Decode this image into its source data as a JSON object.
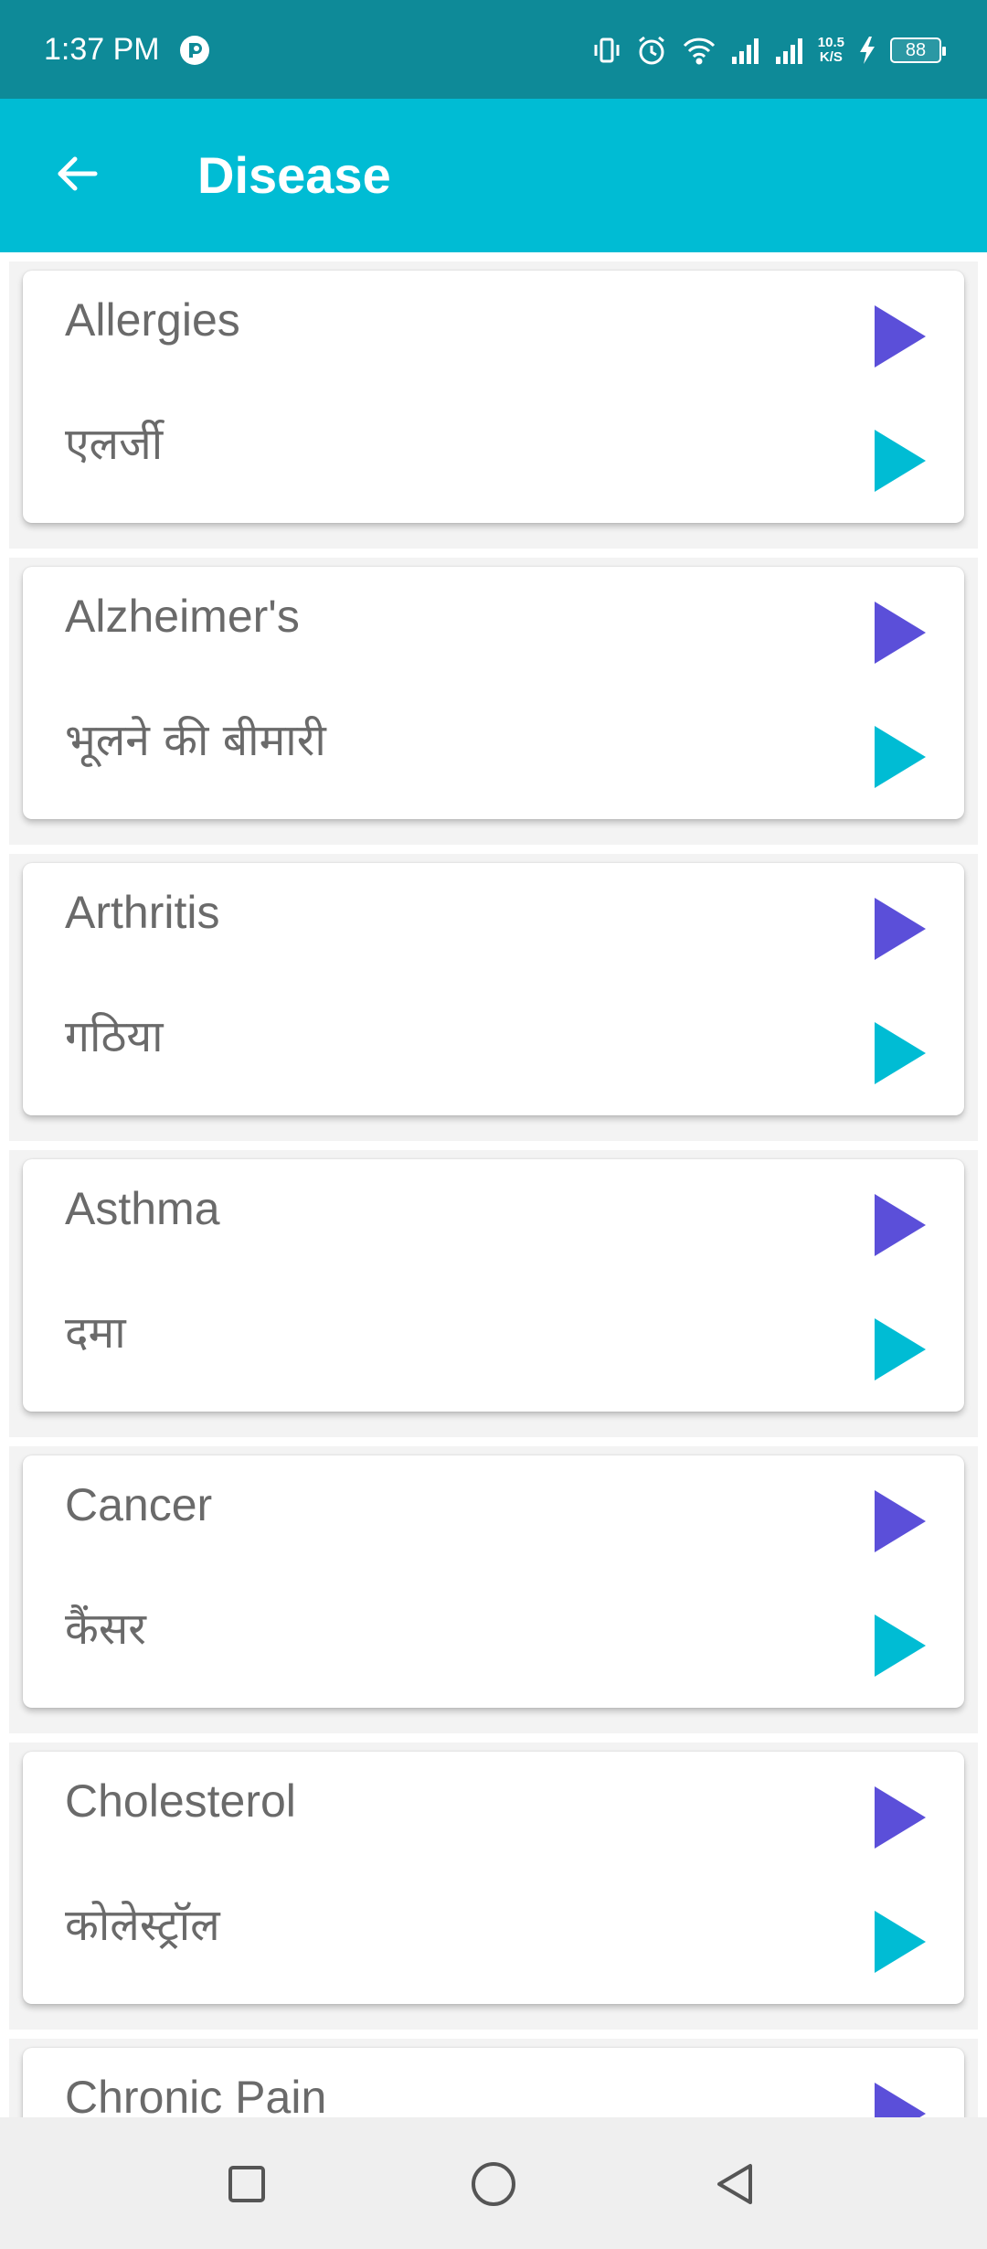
{
  "status_bar": {
    "time": "1:37 PM",
    "net_speed_value": "10.5",
    "net_speed_unit": "K/S",
    "battery_level": "88"
  },
  "app_bar": {
    "title": "Disease",
    "background_color": "#00bcd4"
  },
  "colors": {
    "english_play": "#5b4fd9",
    "hindi_play": "#00bcd4",
    "label_text": "#6a6a6a"
  },
  "diseases": [
    {
      "english": "Allergies",
      "hindi": "एलर्जी"
    },
    {
      "english": "Alzheimer's",
      "hindi": "भूलने की बीमारी"
    },
    {
      "english": "Arthritis",
      "hindi": "गठिया"
    },
    {
      "english": "Asthma",
      "hindi": "दमा"
    },
    {
      "english": "Cancer",
      "hindi": "कैंसर"
    },
    {
      "english": "Cholesterol",
      "hindi": "कोलेस्ट्रॉल"
    },
    {
      "english": "Chronic Pain",
      "hindi": ""
    }
  ],
  "icons": {
    "back": "arrow-left-icon",
    "play": "play-triangle-icon",
    "nav_recents": "square-icon",
    "nav_home": "circle-icon",
    "nav_back": "triangle-back-icon"
  }
}
